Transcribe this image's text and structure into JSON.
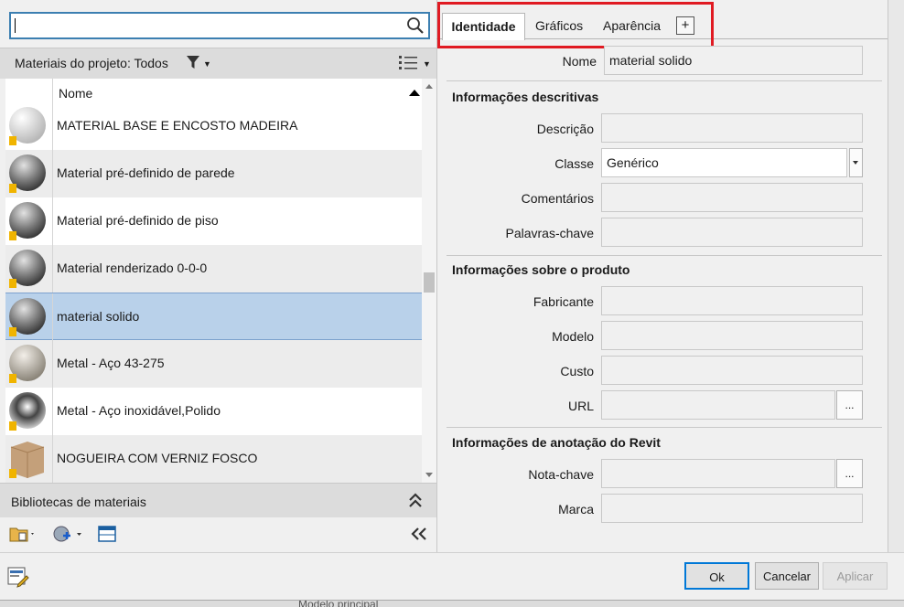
{
  "search": {
    "value": ""
  },
  "project_materials": {
    "label": "Materiais do projeto: Todos"
  },
  "list": {
    "column_name": "Nome",
    "rows": [
      {
        "name": "MATERIAL BASE E ENCOSTO MADEIRA",
        "thumb": "white-sphere"
      },
      {
        "name": "Material pré-definido de parede",
        "thumb": "grey-sphere"
      },
      {
        "name": "Material pré-definido de piso",
        "thumb": "grey-sphere"
      },
      {
        "name": "Material renderizado 0-0-0",
        "thumb": "grey-sphere"
      },
      {
        "name": "material solido",
        "thumb": "grey-sphere",
        "selected": true
      },
      {
        "name": "Metal - Aço 43-275",
        "thumb": "metal-sphere"
      },
      {
        "name": "Metal - Aço inoxidável,Polido",
        "thumb": "chrome-sphere"
      },
      {
        "name": "NOGUEIRA COM VERNIZ FOSCO",
        "thumb": "wood-cube"
      }
    ]
  },
  "libraries": {
    "label": "Bibliotecas de materiais"
  },
  "tabs": {
    "identity": "Identidade",
    "graphics": "Gráficos",
    "appearance": "Aparência",
    "add": "+"
  },
  "identity": {
    "name_label": "Nome",
    "name_value": "material solido",
    "descriptive_title": "Informações descritivas",
    "description_label": "Descrição",
    "class_label": "Classe",
    "class_value": "Genérico",
    "comments_label": "Comentários",
    "keywords_label": "Palavras-chave",
    "product_title": "Informações sobre o produto",
    "manufacturer_label": "Fabricante",
    "model_label": "Modelo",
    "cost_label": "Custo",
    "url_label": "URL",
    "url_button": "...",
    "revit_title": "Informações de anotação do Revit",
    "keynote_label": "Nota-chave",
    "keynote_button": "...",
    "mark_label": "Marca"
  },
  "footer": {
    "ok": "Ok",
    "cancel": "Cancelar",
    "apply": "Aplicar"
  },
  "background": {
    "text": "Modelo principal"
  },
  "colors": {
    "accent": "#0078d7",
    "highlight": "#e01a22",
    "selection": "#b9d1ea"
  }
}
